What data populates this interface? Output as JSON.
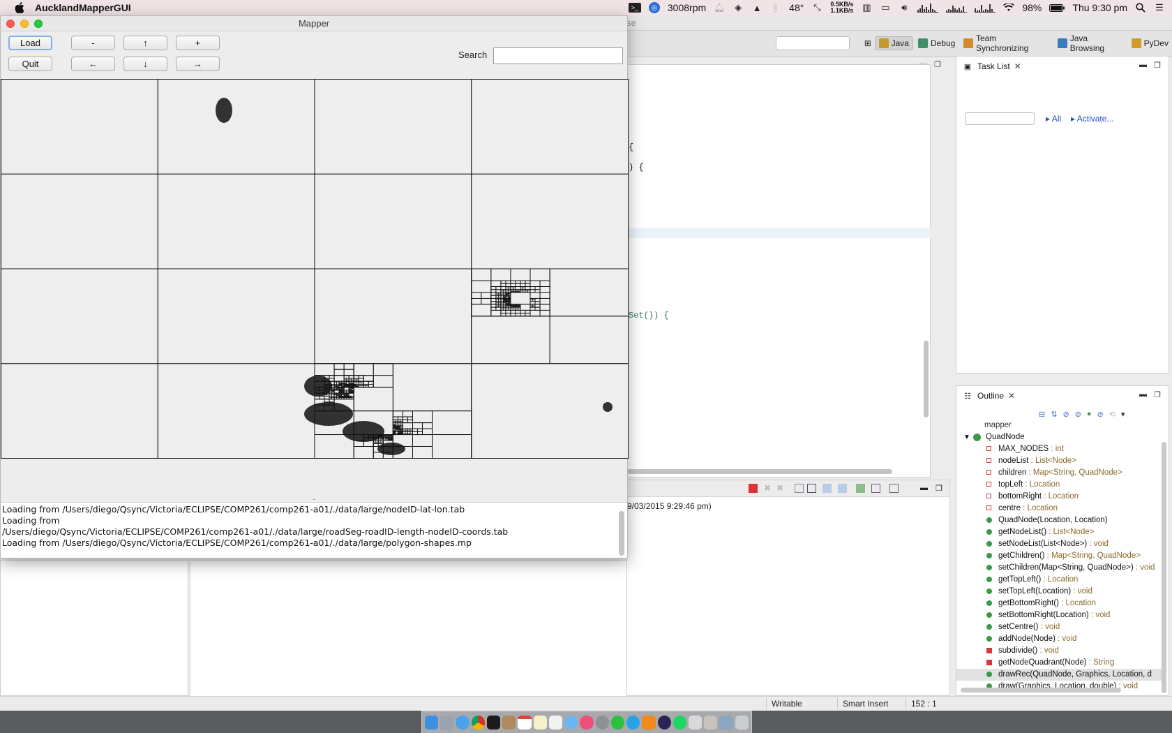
{
  "menubar": {
    "app_name": "AucklandMapperGUI",
    "rpm": "3008rpm",
    "temperature": "48°",
    "net_up": "0.5KB/s",
    "net_down": "1.1KB/s",
    "battery": "98%",
    "clock": "Thu 9:30 pm"
  },
  "eclipse": {
    "title": "QuadNode.java - Eclipse",
    "perspectives": [
      {
        "label": "Java",
        "color": "#c59b31"
      },
      {
        "label": "Debug",
        "color": "#3f8f6a"
      },
      {
        "label": "Team Synchronizing",
        "color": "#d38b2a"
      },
      {
        "label": "Java Browsing",
        "color": "#3a7bc0"
      },
      {
        "label": "PyDev",
        "color": "#d09b2a"
      }
    ],
    "code_fragments": [
      "{",
      ") {",
      "Set()) {"
    ],
    "console_date": "9/03/2015 9:29:46 pm)",
    "task_list": {
      "title": "Task List",
      "link_all": "All",
      "link_activate": "Activate..."
    },
    "outline": {
      "title": "Outline",
      "root_partial": "mapper",
      "class_name": "QuadNode",
      "members": [
        {
          "name": "MAX_NODES",
          "type": " : int",
          "kind": "const"
        },
        {
          "name": "nodeList",
          "type": " : List<Node>",
          "kind": "private-field"
        },
        {
          "name": "children",
          "type": " : Map<String, QuadNode>",
          "kind": "private-field"
        },
        {
          "name": "topLeft",
          "type": " : Location",
          "kind": "private-field"
        },
        {
          "name": "bottomRight",
          "type": " : Location",
          "kind": "private-field"
        },
        {
          "name": "centre",
          "type": " : Location",
          "kind": "private-field"
        },
        {
          "name": "QuadNode(Location, Location)",
          "type": "",
          "kind": "public"
        },
        {
          "name": "getNodeList()",
          "type": " : List<Node>",
          "kind": "public"
        },
        {
          "name": "setNodeList(List<Node>)",
          "type": " : void",
          "kind": "public"
        },
        {
          "name": "getChildren()",
          "type": " : Map<String, QuadNode>",
          "kind": "public"
        },
        {
          "name": "setChildren(Map<String, QuadNode>)",
          "type": " : void",
          "kind": "public"
        },
        {
          "name": "getTopLeft()",
          "type": " : Location",
          "kind": "public"
        },
        {
          "name": "setTopLeft(Location)",
          "type": " : void",
          "kind": "public"
        },
        {
          "name": "getBottomRight()",
          "type": " : Location",
          "kind": "public"
        },
        {
          "name": "setBottomRight(Location)",
          "type": " : void",
          "kind": "public"
        },
        {
          "name": "setCentre()",
          "type": " : void",
          "kind": "public"
        },
        {
          "name": "addNode(Node)",
          "type": " : void",
          "kind": "public"
        },
        {
          "name": "subdivide()",
          "type": " : void",
          "kind": "private-method"
        },
        {
          "name": "getNodeQuadrant(Node)",
          "type": " : String",
          "kind": "private-method"
        },
        {
          "name": "drawRec(QuadNode, Graphics, Location, d",
          "type": "",
          "kind": "public",
          "selected": true
        },
        {
          "name": "draw(Graphics, Location, double)",
          "type": " : void",
          "kind": "public"
        }
      ]
    },
    "status": {
      "writable": "Writable",
      "insert_mode": "Smart Insert",
      "position": "152 : 1"
    }
  },
  "mapper": {
    "title": "Mapper",
    "buttons": {
      "load": "Load",
      "quit": "Quit",
      "zoom_out": "-",
      "up": "↑",
      "zoom_in": "+",
      "left": "←",
      "down": "↓",
      "right": "→"
    },
    "search_label": "Search",
    "search_value": "",
    "console_lines": [
      "Loading from /Users/diego/Qsync/Victoria/ECLIPSE/COMP261/comp261-a01/./data/large/nodeID-lat-lon.tab",
      "Loading from",
      "/Users/diego/Qsync/Victoria/ECLIPSE/COMP261/comp261-a01/./data/large/roadSeg-roadID-length-nodeID-coords.tab",
      "Loading from /Users/diego/Qsync/Victoria/ECLIPSE/COMP261/comp261-a01/./data/large/polygon-shapes.mp"
    ]
  },
  "colors": {
    "map_background": "#eeeeee",
    "quadtree_lines": "#111111",
    "focus_ring": "#7fb1ee",
    "link_blue": "#1f4db8"
  }
}
